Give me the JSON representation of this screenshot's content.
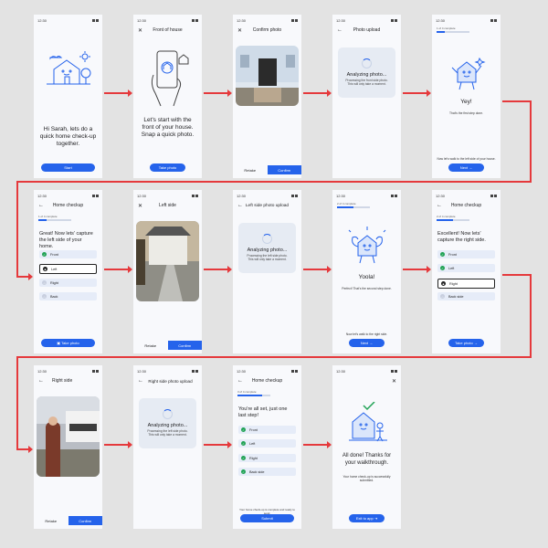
{
  "status_time": "12:30",
  "s1": {
    "text": "Hi Sarah, lets do a quick home check-up together.",
    "button": "Start"
  },
  "s2": {
    "title": "Front of house",
    "text": "Let's start with the front of your house. Snap a quick photo.",
    "button": "Take photo"
  },
  "s3": {
    "title": "Confirm photo",
    "retake": "Retake",
    "confirm": "Confirm"
  },
  "s4": {
    "title": "Photo upload",
    "analyzing": "Analyzing photo...",
    "desc": "Processing the front side photo. This will only take a moment."
  },
  "s5": {
    "progress": "1 of 4 complete",
    "progress_value": 0.25,
    "heading": "Yey!",
    "sub": "That's the first step done.",
    "note": "Now let's walk to the left side of your house.",
    "button": "Next"
  },
  "s6": {
    "title": "Home checkup",
    "progress": "1 of 4 complete",
    "progress_value": 0.25,
    "text": "Great! Now lets' capture the left side of your home.",
    "options": [
      "Front",
      "Left",
      "Right",
      "Back"
    ],
    "button": "Take photo"
  },
  "s7": {
    "title": "Left side",
    "retake": "Retake",
    "confirm": "Confirm"
  },
  "s8": {
    "title": "Left side photo upload",
    "analyzing": "Analyzing photo...",
    "desc": "Processing the left side photo. This will only take a moment."
  },
  "s9": {
    "progress": "2 of 4 complete",
    "progress_value": 0.5,
    "heading": "Yoola!",
    "sub": "Perfect! That's the second step done.",
    "note": "Now let's walk to the right side.",
    "button": "Next"
  },
  "s10": {
    "title": "Home checkup",
    "progress": "2 of 4 complete",
    "progress_value": 0.5,
    "text": "Excellent! Now lets' capture the right side.",
    "options": [
      "Front",
      "Left",
      "Right",
      "Back side"
    ],
    "button": "Take photo"
  },
  "s11": {
    "title": "Right side",
    "retake": "Retake",
    "confirm": "Confirm"
  },
  "s12": {
    "title": "Right side photo upload",
    "analyzing": "Analyzing photo...",
    "desc": "Processing the left side photo. This will only take a moment."
  },
  "s13": {
    "title": "Home checkup",
    "progress": "3 of 4 complete",
    "progress_value": 0.75,
    "text": "You're all set, just one last step!",
    "options": [
      "Front",
      "Left",
      "Right",
      "Back side"
    ],
    "note": "Your home check-up is complete and ready to send.",
    "button": "Submit"
  },
  "s14": {
    "text": "All done! Thanks for your walkthrough.",
    "sub": "Your home check-up is successfully submitted.",
    "button": "Exit to app"
  },
  "colors": {
    "accent": "#2563eb",
    "arrow": "#e5393c",
    "success": "#22a356"
  }
}
